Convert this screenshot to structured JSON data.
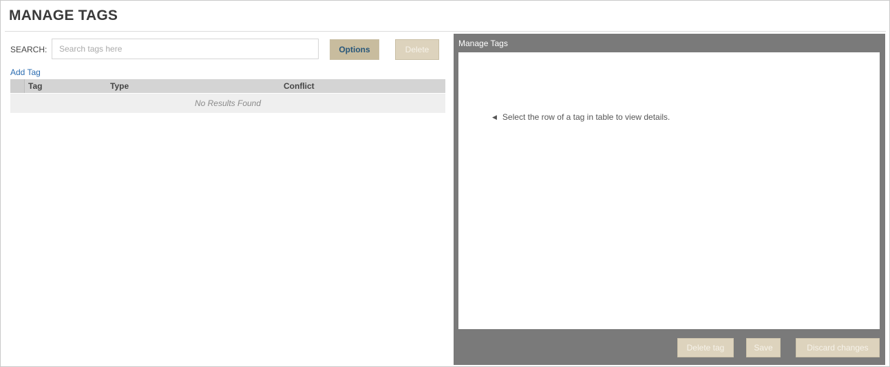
{
  "page": {
    "title": "MANAGE TAGS"
  },
  "search": {
    "label": "SEARCH:",
    "placeholder": "Search tags here",
    "value": ""
  },
  "toolbar": {
    "options_label": "Options",
    "delete_label": "Delete",
    "add_tag_label": "Add Tag"
  },
  "table": {
    "columns": [
      "Tag",
      "Type",
      "Conflict"
    ],
    "rows": [],
    "empty_text": "No Results Found"
  },
  "details_panel": {
    "title": "Manage Tags",
    "hint": "Select the row of a tag in table to view details.",
    "buttons": {
      "delete_tag": "Delete tag",
      "save": "Save",
      "discard": "Discard changes"
    }
  },
  "icons": {
    "hint_arrow": "caret-left-icon"
  },
  "colors": {
    "primary_button": "#c8bc9e",
    "primary_button_text": "#27567a",
    "disabled_button": "#ddd3bd",
    "panel_bg": "#7a7a7a",
    "link": "#2b6cb0"
  }
}
